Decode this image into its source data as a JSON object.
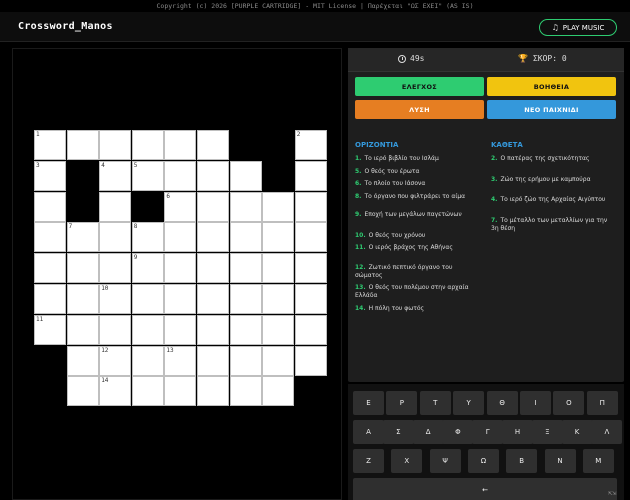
{
  "copyright": "Copyright (c) 2026 [PURPLE CARTRIDGE] - MIT License | Παρέχεται \"ΩΣ ΕΧΕΙ\" (AS IS)",
  "header": {
    "title": "Crossword_Manos",
    "music_label": "PLAY MUSIC",
    "music_icon": "music-note-icon"
  },
  "stats": {
    "timer": "49s",
    "score_label": "ΣΚΟΡ: 0"
  },
  "buttons": {
    "check": "ΕΛΕΓΧΟΣ",
    "help": "ΒΟΗΘΕΙΑ",
    "solve": "ΛΥΣΗ",
    "new_game": "ΝΕΟ ΠΑΙΧΝΙΔΙ"
  },
  "colors": {
    "check": "#2ecc71",
    "help": "#f1c40f",
    "solve": "#e67e22",
    "new_game": "#3498db",
    "clue_title": "#3498db",
    "clue_number": "#2ecc71"
  },
  "clues": {
    "across_title": "ΟΡΙΖΟΝΤΙΑ",
    "down_title": "ΚΑΘΕΤΑ",
    "across": [
      {
        "num": "1.",
        "text": "Το ιερό βιβλίο του Ισλάμ"
      },
      {
        "num": "5.",
        "text": "Ο θεός του έρωτα"
      },
      {
        "num": "6.",
        "text": "Το πλοίο του Ιάσονα"
      },
      {
        "num": "8.",
        "text": "Το όργανο που φιλτράρει το αίμα"
      },
      {
        "num": "9.",
        "text": "Εποχή των μεγάλων παγετώνων"
      },
      {
        "num": "10.",
        "text": "Ο θεός του χρόνου"
      },
      {
        "num": "11.",
        "text": "Ο ιερός βράχος της Αθήνας"
      },
      {
        "num": "12.",
        "text": "Ζωτικό πεπτικό όργανο του σώματος"
      },
      {
        "num": "13.",
        "text": "Ο θεός του πολέμου στην αρχαία Ελλάδα"
      },
      {
        "num": "14.",
        "text": "Η πόλη του φωτός"
      }
    ],
    "down": [
      {
        "num": "2.",
        "text": "Ο πατέρας της σχετικότητας"
      },
      {
        "num": "3.",
        "text": "Ζώο της ερήμου με καμπούρα"
      },
      {
        "num": "4.",
        "text": "Το ιερό ζώο της Αρχαίας Αιγύπτου"
      },
      {
        "num": "7.",
        "text": "Το μέταλλο των μεταλλίων για την 3η θέση"
      }
    ]
  },
  "grid": {
    "rows": 9,
    "cols": 9,
    "cells": [
      [
        "1",
        "",
        "",
        "",
        "",
        "",
        "#",
        "#",
        "2"
      ],
      [
        "3",
        "#",
        "4",
        "5",
        "",
        "",
        "",
        "#",
        ""
      ],
      [
        "",
        "#",
        "",
        "#",
        "6",
        "",
        "",
        "",
        ""
      ],
      [
        "",
        "7",
        "",
        "8",
        "",
        "",
        "",
        "",
        ""
      ],
      [
        "",
        "",
        "",
        "9",
        "",
        "",
        "",
        "",
        ""
      ],
      [
        "",
        "",
        "10",
        "",
        "",
        "",
        "",
        "",
        ""
      ],
      [
        "11",
        "",
        "",
        "",
        "",
        "",
        "",
        "",
        ""
      ],
      [
        "#",
        "",
        "12",
        "",
        "13",
        "",
        "",
        "",
        ""
      ],
      [
        "-",
        "",
        "14",
        "",
        "",
        "",
        "",
        "",
        "-"
      ]
    ]
  },
  "keyboard": {
    "row1": [
      "Ε",
      "Ρ",
      "Τ",
      "Υ",
      "Θ",
      "Ι",
      "Ο",
      "Π"
    ],
    "row2": [
      "Α",
      "Σ",
      "Δ",
      "Φ",
      "Γ",
      "Η",
      "Ξ",
      "Κ",
      "Λ"
    ],
    "row3": [
      "Ζ",
      "Χ",
      "Ψ",
      "Ω",
      "Β",
      "Ν",
      "Μ"
    ],
    "backspace": "←"
  }
}
